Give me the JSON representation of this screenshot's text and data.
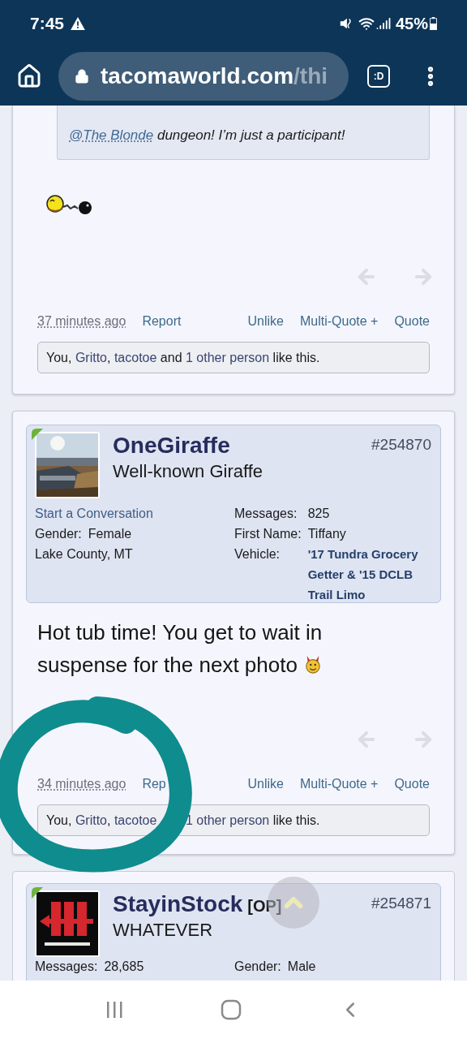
{
  "status_bar": {
    "time": "7:45",
    "battery": "45%"
  },
  "browser": {
    "url_host": "tacomaworld.com",
    "url_path": "/thi",
    "tab_switcher": ":D"
  },
  "posts": [
    {
      "kind": "continued",
      "quote": {
        "mention": "@The Blonde",
        "text": " dungeon! I’m just a participant!"
      },
      "time": "37 minutes ago",
      "actions": {
        "report": "Report",
        "unlike": "Unlike",
        "multi_quote": "Multi-Quote +",
        "quote": "Quote"
      },
      "likes": [
        [
          {
            "text": "You, ",
            "link": false
          },
          {
            "text": "Gritto",
            "link": true
          },
          {
            "text": ", ",
            "link": false
          },
          {
            "text": "tacotoe",
            "link": true
          },
          {
            "text": " and ",
            "link": false
          },
          {
            "text": "1 other person",
            "link": true
          },
          {
            "text": " like this.",
            "link": false
          }
        ]
      ]
    },
    {
      "kind": "full",
      "user": {
        "name": "OneGiraffe",
        "title": "Well-known Giraffe",
        "post_number": "#254870",
        "left_fields": [
          {
            "kind": "link",
            "text": "Start a Conversation"
          },
          {
            "kind": "field",
            "label": "Gender:",
            "value": "Female"
          },
          {
            "kind": "plain",
            "text": "Lake County, MT"
          }
        ],
        "right_fields": [
          {
            "label": "Messages:",
            "value": "825",
            "link": false
          },
          {
            "label": "First Name:",
            "value": "Tiffany",
            "link": false
          },
          {
            "label": "Vehicle:",
            "value": "'17 Tundra Grocery Getter & '15 DCLB Trail Limo",
            "link": true
          }
        ]
      },
      "message_lines": [
        "Hot tub time! You get to wait in",
        "suspense for the next photo"
      ],
      "time": "34 minutes ago",
      "actions": {
        "report": "Rep",
        "unlike": "Unlike",
        "multi_quote": "Multi-Quote +",
        "quote": "Quote"
      },
      "likes": [
        [
          {
            "text": "You, ",
            "link": false
          },
          {
            "text": "Gritto",
            "link": true
          },
          {
            "text": ", ",
            "link": false
          },
          {
            "text": "tacotoe",
            "link": true
          }
        ],
        [
          {
            "text": "1 other person",
            "link": true
          },
          {
            "text": " like this.",
            "link": false
          }
        ]
      ]
    },
    {
      "kind": "partial",
      "user": {
        "name": "StayinStock",
        "badge": "[OP]",
        "title": "WHATEVER",
        "post_number": "#254871",
        "bottom_fields": [
          {
            "label": "Messages:",
            "value": "28,685"
          },
          {
            "label": "Gender:",
            "value": "Male"
          }
        ]
      }
    }
  ]
}
